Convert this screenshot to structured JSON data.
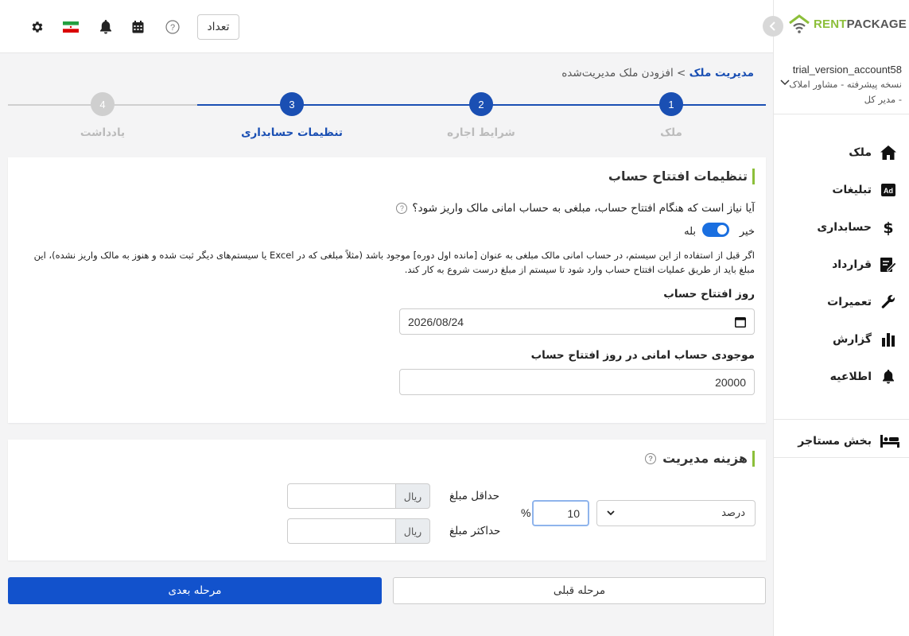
{
  "header": {
    "count_button": "تعداد",
    "icons": [
      "settings-icon",
      "iran-flag-icon",
      "bell-icon",
      "calendar-icon",
      "help-icon"
    ]
  },
  "sidebar": {
    "logo": {
      "rent": "RENT",
      "package": "PACKAGE"
    },
    "account": {
      "name": "trial_version_account58",
      "role_line1": "نسخه پیشرفته - مشاور املاک",
      "role_line2": "- مدیر کل"
    },
    "items": [
      {
        "label": "ملک",
        "icon": "home-icon"
      },
      {
        "label": "تبلیغات",
        "icon": "ad-icon"
      },
      {
        "label": "حسابداری",
        "icon": "dollar-icon"
      },
      {
        "label": "قرارداد",
        "icon": "contract-icon"
      },
      {
        "label": "تعمیرات",
        "icon": "wrench-icon"
      },
      {
        "label": "گزارش",
        "icon": "chart-icon"
      },
      {
        "label": "اطلاعیه",
        "icon": "bell-icon"
      }
    ],
    "tenant": {
      "label": "بخش مستاجر",
      "icon": "bed-icon"
    }
  },
  "breadcrumb": {
    "link": "مدیریت ملک",
    "separator": ">",
    "current": "افزودن ملک مدیریت‌شده"
  },
  "stepper": {
    "steps": [
      {
        "number": "1",
        "label": "ملک",
        "state": "done"
      },
      {
        "number": "2",
        "label": "شرایط اجاره",
        "state": "done"
      },
      {
        "number": "3",
        "label": "تنظیمات حسابداری",
        "state": "active"
      },
      {
        "number": "4",
        "label": "یادداشت",
        "state": "pending"
      }
    ],
    "colors": {
      "active": "#1a4fb3",
      "pending": "#cfcfcf"
    }
  },
  "opening": {
    "title": "تنظیمات افتتاح حساب",
    "question": "آیا نیاز است که هنگام افتتاح حساب، مبلغی به حساب امانی مالک واریز شود؟",
    "toggle_no": "خیر",
    "toggle_yes": "بله",
    "help_line1": "اگر قبل از استفاده از این سیستم، در حساب امانی مالک مبلغی به عنوان [مانده اول دوره] موجود باشد (مثلاً مبلغی که در Excel یا سیستم‌های دیگر ثبت شده و هنوز به مالک واریز نشده)، این",
    "help_line2": "مبلغ باید از طریق عملیات افتتاح حساب وارد شود تا سیستم از مبلغ درست شروع به کار کند.",
    "date_label": "روز افتتاح حساب",
    "date_value": "2026/08/24",
    "balance_label": "موجودی حساب امانی در روز افتتاح حساب",
    "balance_value": "20000"
  },
  "management_fee": {
    "title": "هزینه مدیریت",
    "type_value": "درصد",
    "percent_value": "10",
    "percent_sign": "%",
    "min_label": "حداقل مبلغ",
    "max_label": "حداکثر مبلغ",
    "currency": "ریال"
  },
  "buttons": {
    "previous": "مرحله قبلی",
    "next": "مرحله بعدی"
  }
}
